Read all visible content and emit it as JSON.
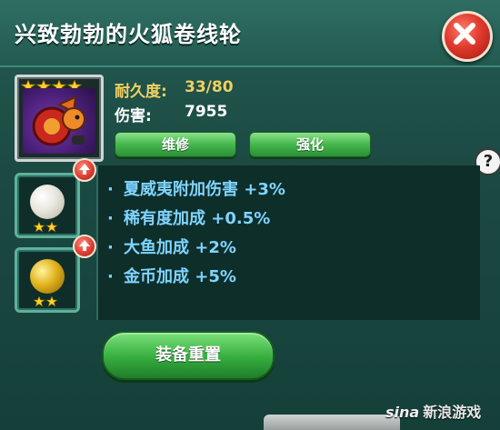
{
  "dialog": {
    "title": "兴致勃勃的火狐卷线轮",
    "close_icon": "close-x-icon"
  },
  "item": {
    "stars": 4,
    "durability_label": "耐久度:",
    "durability_value": "33/80",
    "damage_label": "伤害:",
    "damage_value": "7955",
    "repair_label": "维修",
    "upgrade_label": "强化"
  },
  "pearls": [
    {
      "color": "white",
      "stars": 2
    },
    {
      "color": "gold",
      "stars": 2
    }
  ],
  "effects": [
    {
      "text": "夏威夷附加伤害 +3%"
    },
    {
      "text": "稀有度加成 +0.5%"
    },
    {
      "text": "大鱼加成 +2%"
    },
    {
      "text": "金币加成 +5%"
    }
  ],
  "reset_button": "装备重置",
  "help_label": "?",
  "watermark": {
    "logo": "sina",
    "text": "新浪游戏"
  },
  "colors": {
    "accent_gold": "#f0d060",
    "effect_blue": "#7fd4ff",
    "button_green": "#44b64c"
  }
}
